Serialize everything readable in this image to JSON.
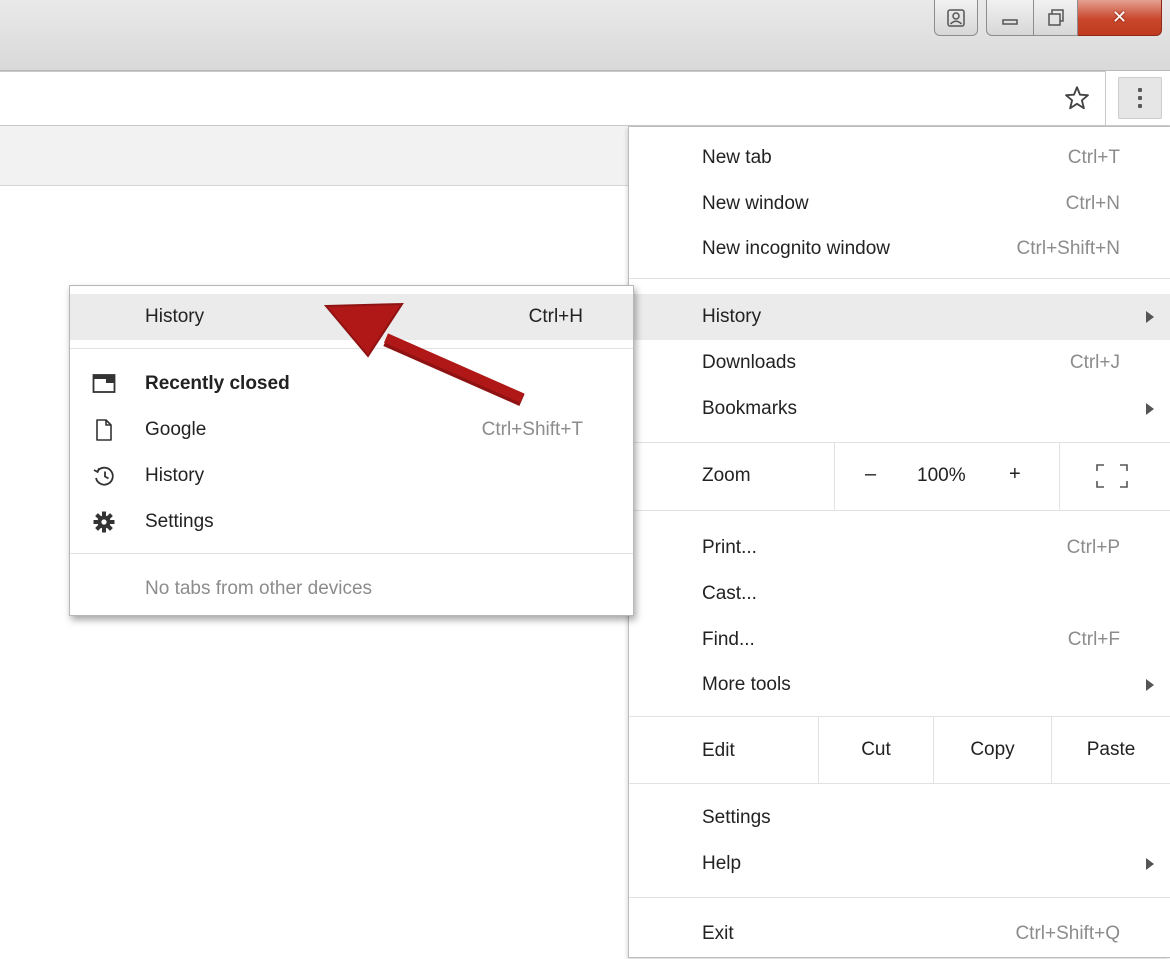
{
  "main_menu": {
    "new_tab": {
      "label": "New tab",
      "shortcut": "Ctrl+T"
    },
    "new_window": {
      "label": "New window",
      "shortcut": "Ctrl+N"
    },
    "new_incognito": {
      "label": "New incognito window",
      "shortcut": "Ctrl+Shift+N"
    },
    "history": {
      "label": "History"
    },
    "downloads": {
      "label": "Downloads",
      "shortcut": "Ctrl+J"
    },
    "bookmarks": {
      "label": "Bookmarks"
    },
    "zoom": {
      "label": "Zoom",
      "minus": "–",
      "value": "100%",
      "plus": "+"
    },
    "print": {
      "label": "Print...",
      "shortcut": "Ctrl+P"
    },
    "cast": {
      "label": "Cast..."
    },
    "find": {
      "label": "Find...",
      "shortcut": "Ctrl+F"
    },
    "more_tools": {
      "label": "More tools"
    },
    "edit": {
      "label": "Edit",
      "cut": "Cut",
      "copy": "Copy",
      "paste": "Paste"
    },
    "settings": {
      "label": "Settings"
    },
    "help": {
      "label": "Help"
    },
    "exit": {
      "label": "Exit",
      "shortcut": "Ctrl+Shift+Q"
    }
  },
  "history_submenu": {
    "history": {
      "label": "History",
      "shortcut": "Ctrl+H"
    },
    "recently_closed": {
      "label": "Recently closed"
    },
    "google": {
      "label": "Google",
      "shortcut": "Ctrl+Shift+T"
    },
    "history_entry": {
      "label": "History"
    },
    "settings_entry": {
      "label": "Settings"
    },
    "no_tabs": {
      "label": "No tabs from other devices"
    }
  },
  "colors": {
    "annotation_arrow": "#b01717",
    "close_button": "#c9462c",
    "highlight": "#ebebeb"
  },
  "icons": {
    "window_user": "user-icon",
    "window_minimize": "minimize-icon",
    "window_maximize": "restore-icon",
    "window_close": "close-icon",
    "bookmark_star": "star-icon",
    "chrome_menu": "vertical-dots-icon",
    "recently_closed": "window-icon",
    "google": "page-icon",
    "history": "history-clock-icon",
    "settings": "gear-icon",
    "fullscreen": "fullscreen-icon"
  }
}
